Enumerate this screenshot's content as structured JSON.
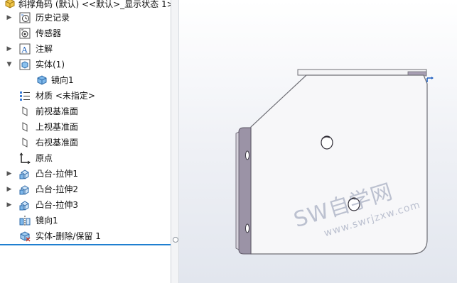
{
  "tree": {
    "root_label": "斜撑角码 (默认) <<默认>_显示状态 1>",
    "items": [
      {
        "label": "历史记录",
        "icon": "history-icon",
        "expandable": true
      },
      {
        "label": "传感器",
        "icon": "sensor-icon",
        "expandable": false
      },
      {
        "label": "注解",
        "icon": "annotation-icon",
        "expandable": true
      },
      {
        "label": "实体(1)",
        "icon": "solid-bodies-folder-icon",
        "expandable": true,
        "expanded": true
      },
      {
        "label": "镜向1",
        "icon": "solid-body-icon",
        "expandable": false,
        "child": true
      },
      {
        "label": "材质 <未指定>",
        "icon": "material-icon",
        "expandable": false
      },
      {
        "label": "前视基准面",
        "icon": "plane-icon",
        "expandable": false
      },
      {
        "label": "上视基准面",
        "icon": "plane-icon",
        "expandable": false
      },
      {
        "label": "右视基准面",
        "icon": "plane-icon",
        "expandable": false
      },
      {
        "label": "原点",
        "icon": "origin-icon",
        "expandable": false
      },
      {
        "label": "凸台-拉伸1",
        "icon": "extrude-boss-icon",
        "expandable": true
      },
      {
        "label": "凸台-拉伸2",
        "icon": "extrude-boss-icon",
        "expandable": true
      },
      {
        "label": "凸台-拉伸3",
        "icon": "extrude-boss-icon",
        "expandable": true
      },
      {
        "label": "镜向1",
        "icon": "mirror-feature-icon",
        "expandable": false
      },
      {
        "label": "实体-删除/保留 1",
        "icon": "body-delete-keep-icon",
        "expandable": false
      }
    ]
  },
  "watermark": {
    "main": "SW自学网",
    "url": "www.swrjzxw.com"
  },
  "colors": {
    "selection_accent": "#1f7fd0",
    "part_face": "#f7f7f9",
    "part_edge": "#6f6f76",
    "part_side": "#9b93a6"
  }
}
